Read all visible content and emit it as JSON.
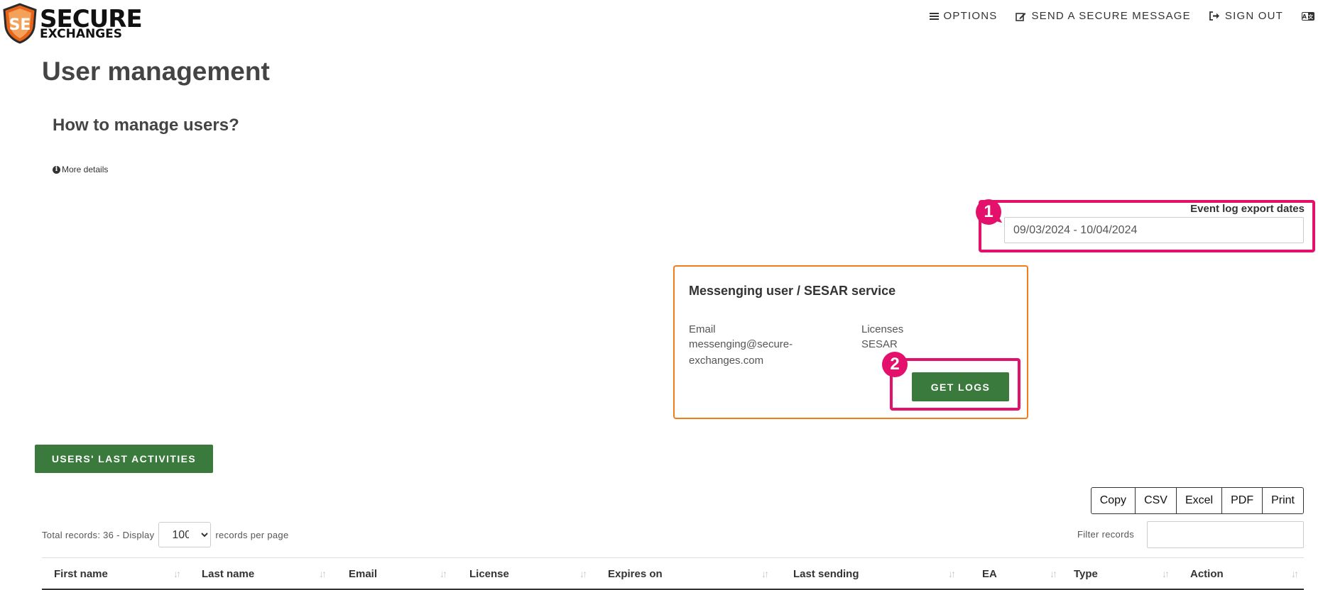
{
  "header": {
    "logo_line1": "SECURE",
    "logo_line2": "EXCHANGES",
    "nav": {
      "options": "OPTIONS",
      "send_message": "SEND A SECURE MESSAGE",
      "sign_out": "SIGN OUT"
    },
    "language_icon": "translate-icon"
  },
  "page": {
    "title": "User management",
    "help_title": "How to manage users?",
    "more_details": "More details"
  },
  "event_log": {
    "label": "Event log export dates",
    "date_range": "09/03/2024 - 10/04/2024",
    "badge": "1"
  },
  "service_card": {
    "title": "Messenging user / SESAR service",
    "email_label": "Email",
    "email_value_line1": "messenging@secure-",
    "email_value_line2": "exchanges.com",
    "licenses_label": "Licenses",
    "licenses_value": "SESAR",
    "get_logs": "GET LOGS",
    "badge": "2"
  },
  "activities_button": "USERS' LAST ACTIVITIES",
  "export_buttons": [
    "Copy",
    "CSV",
    "Excel",
    "PDF",
    "Print"
  ],
  "records": {
    "prefix": "Total records: 36 - Display",
    "page_size": "100",
    "page_size_options": [
      "100"
    ],
    "suffix": "records per page",
    "filter_label": "Filter records"
  },
  "table": {
    "columns": [
      "First name",
      "Last name",
      "Email",
      "License",
      "Expires on",
      "Last sending",
      "EA",
      "Type",
      "Action"
    ]
  },
  "colors": {
    "accent_green": "#3a7b3d",
    "highlight_pink": "#e3106c",
    "card_border_orange": "#f07d1a",
    "logo_orange": "#e8641b"
  }
}
